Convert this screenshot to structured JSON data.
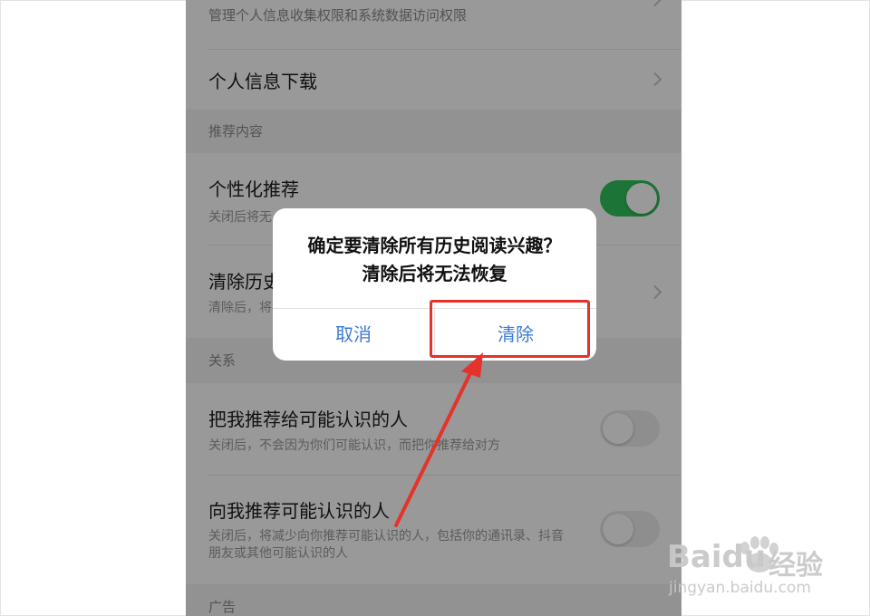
{
  "settings": {
    "top_sub": "管理个人信息收集权限和系统数据访问权限",
    "download_title": "个人信息下载",
    "section_recommend": "推荐内容",
    "personalized_title": "个性化推荐",
    "personalized_sub": "关闭后将无",
    "clear_history_title": "清除历史",
    "clear_history_sub": "清除后，将",
    "section_relation": "关系",
    "recommend_me_title": "把我推荐给可能认识的人",
    "recommend_me_sub": "关闭后，不会因为你们可能认识，而把你推荐给对方",
    "recommend_to_me_title": "向我推荐可能认识的人",
    "recommend_to_me_sub": "关闭后，将减少向你推荐可能认识的人，包括你的通讯录、抖音朋友或其他可能认识的人",
    "section_ads": "广告",
    "personalized_on": true,
    "recommend_me_on": false,
    "recommend_to_me_on": false
  },
  "dialog": {
    "message": "确定要清除所有历史阅读兴趣？清除后将无法恢复",
    "cancel_label": "取消",
    "confirm_label": "清除"
  },
  "watermark": {
    "brand": "Baidu",
    "suffix": "经验",
    "url": "jingyan.baidu.com"
  },
  "colors": {
    "toggle_on": "#2fc25b",
    "dialog_button": "#3d7ad8",
    "annotation": "#e5322a"
  }
}
